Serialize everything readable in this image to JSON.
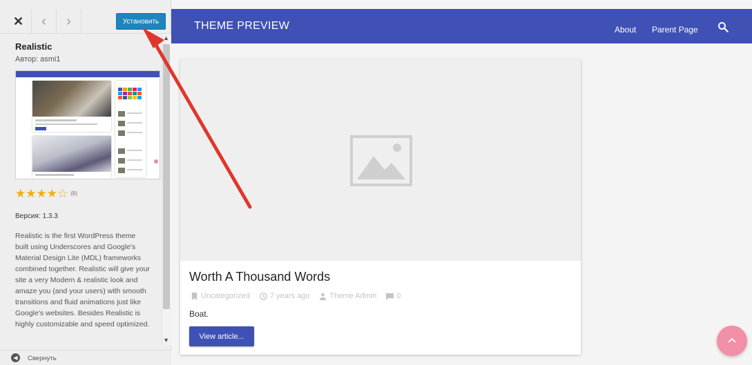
{
  "sidebar": {
    "close_glyph": "✕",
    "prev_glyph": "‹",
    "next_glyph": "›",
    "install_label": "Установить",
    "theme": {
      "name": "Realistic",
      "author_label": "Автор:",
      "author": "asmi1",
      "rating": 4,
      "rating_max": 5,
      "rating_count": "(8)",
      "version_label": "Версия:",
      "version": "1.3.3",
      "description": "Realistic is the first WordPress theme built using Underscores and Google's Material Design Lite (MDL) frameworks combined together. Realistic will give your site a very Modern & realistic look and amaze you (and your users) with smooth transitions and fluid animations just like Google's websites. Besides Realistic is highly customizable and speed optimized."
    },
    "collapse_label": "Свернуть"
  },
  "preview": {
    "site_title": "THEME PREVIEW",
    "nav": [
      "About",
      "Parent Page"
    ],
    "post": {
      "title": "Worth A Thousand Words",
      "category": "Uncategorized",
      "date": "7 years ago",
      "author": "Theme Admin",
      "comments": "0",
      "excerpt": "Boat.",
      "button_label": "View article..."
    }
  },
  "colors": {
    "header": "#3f51b5",
    "install_button": "#1e85be",
    "star": "#f0b00c",
    "fab": "#f18fa6",
    "annotation_arrow": "#e0362c"
  },
  "icons": {
    "close": "close-icon",
    "prev": "chevron-left-icon",
    "next": "chevron-right-icon",
    "search": "search-icon",
    "category": "bookmark-icon",
    "date": "clock-icon",
    "author": "person-icon",
    "comments": "comment-icon",
    "image_placeholder": "image-placeholder-icon",
    "collapse": "collapse-icon",
    "back_to_top": "chevron-up-icon"
  }
}
